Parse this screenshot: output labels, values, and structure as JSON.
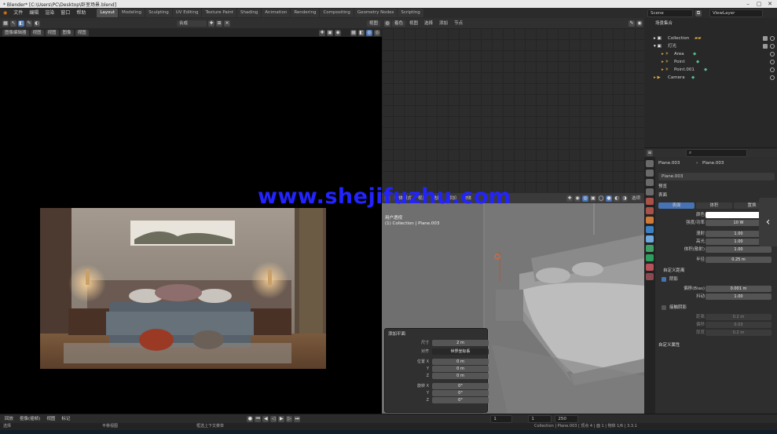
{
  "window": {
    "title": "* Blender* [C:\\Users\\PC\\Desktop\\卧室场景.blend]"
  },
  "menu": [
    "文件",
    "编辑",
    "渲染",
    "窗口",
    "帮助"
  ],
  "workspaces": [
    "Layout",
    "Modeling",
    "Sculpting",
    "UV Editing",
    "Texture Paint",
    "Shading",
    "Animation",
    "Rendering",
    "Compositing",
    "Geometry Nodes",
    "Scripting"
  ],
  "active_workspace": "Layout",
  "scene_header": {
    "scene": "Scene",
    "view_layer": "ViewLayer"
  },
  "render_window": {
    "editor": "图像编辑器",
    "menus": [
      "视图",
      "视图",
      "图像",
      "视图"
    ],
    "slot": "合成",
    "right_button": "视图"
  },
  "node_editor": {
    "editor": "着色",
    "menus": [
      "视图",
      "选择",
      "添加",
      "节点"
    ]
  },
  "viewport": {
    "mode": "物体模式",
    "menus": [
      "视图",
      "选择",
      "添加",
      "物体"
    ],
    "overlay_lines": [
      "用户透视",
      "(1) Collection | Plane.003"
    ],
    "options_button": "选项"
  },
  "operator_panel": {
    "title": "添加平面",
    "rows": [
      {
        "label": "尺寸",
        "value": "2 m"
      },
      {
        "label": "对齐",
        "value": "世界坐标系"
      },
      {
        "label": "位置 X",
        "value": "0 m"
      },
      {
        "label": "Y",
        "value": "0 m"
      },
      {
        "label": "Z",
        "value": "0 m"
      },
      {
        "label": "旋转 X",
        "value": "0°"
      },
      {
        "label": "Y",
        "value": "0°"
      },
      {
        "label": "Z",
        "value": "0°"
      }
    ]
  },
  "outliner": {
    "root": "场景集合",
    "items": [
      {
        "name": "Collection",
        "indent": 1
      },
      {
        "name": "灯光",
        "indent": 1
      },
      {
        "name": "Area",
        "indent": 2
      },
      {
        "name": "Point",
        "indent": 2
      },
      {
        "name": "Point.001",
        "indent": 2
      },
      {
        "name": "Camera",
        "indent": 1
      }
    ]
  },
  "properties": {
    "object_name": "Plane.003",
    "data_name": "Plane.003",
    "material": "Plane.003",
    "sections": [
      "预览",
      "表面"
    ],
    "tabs": [
      "表面",
      "体积",
      "置换"
    ],
    "fields": [
      {
        "label": "颜色",
        "value": ""
      },
      {
        "label": "强度/功率",
        "value": "10 W"
      },
      {
        "label": "漫射",
        "value": "1.00"
      },
      {
        "label": "高光",
        "value": "1.00"
      },
      {
        "label": "体积(散射)",
        "value": "1.00"
      },
      {
        "label": "半径",
        "value": "0.25 m"
      }
    ],
    "subsections": [
      "自定义距离",
      "阴影",
      "接触阴影",
      "自定义属性"
    ],
    "shadow_fields": [
      {
        "label": "偏移(Bias)",
        "value": "0.001 m"
      },
      {
        "label": "抖动",
        "value": "1.00"
      }
    ],
    "contact_fields": [
      {
        "label": "距离",
        "value": "0.2 m"
      },
      {
        "label": "偏移",
        "value": "0.03"
      },
      {
        "label": "厚度",
        "value": "0.2 m"
      }
    ]
  },
  "timeline": {
    "menus": [
      "回放",
      "抠像(插帧)",
      "视图",
      "标记"
    ],
    "frame": "1",
    "start": "1",
    "end": "250"
  },
  "status": {
    "left": "选择",
    "middle": "平移视图",
    "right_hint": "框选上下文菜单",
    "version": "Collection | Plane.003 | 顶点 4 | 面 1 | 物体 1/6 | 3.3.1"
  },
  "watermark": "www.shejifuzhu.com",
  "colors": {
    "accent": "#4772b3",
    "watermark": "#2323ff",
    "collection_icon": "#e0a94a"
  }
}
